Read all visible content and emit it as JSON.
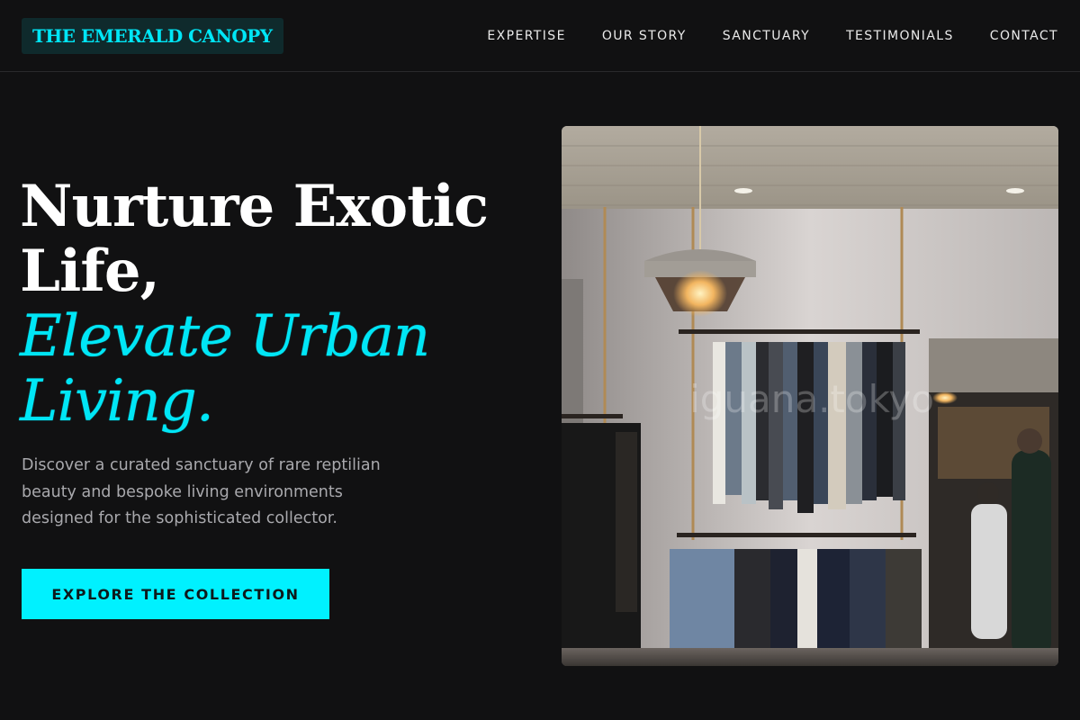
{
  "brand": {
    "name": "THE EMERALD CANOPY"
  },
  "nav": {
    "items": [
      {
        "label": "EXPERTISE"
      },
      {
        "label": "OUR STORY"
      },
      {
        "label": "SANCTUARY"
      },
      {
        "label": "TESTIMONIALS"
      },
      {
        "label": "CONTACT"
      }
    ]
  },
  "hero": {
    "title_line1": "Nurture Exotic",
    "title_line2": "Life,",
    "title_accent_line1": "Elevate Urban",
    "title_accent_line2": "Living.",
    "description": "Discover a curated sanctuary of rare reptilian beauty and bespoke living environments designed for the sophisticated collector.",
    "cta_label": "EXPLORE THE COLLECTION",
    "image_watermark": "iguana.tokyo"
  },
  "colors": {
    "background": "#111112",
    "accent": "#00e6f6",
    "cta_background": "#00f1ff",
    "logo_background": "#0f2a2c",
    "body_text": "#a9a9ad"
  }
}
